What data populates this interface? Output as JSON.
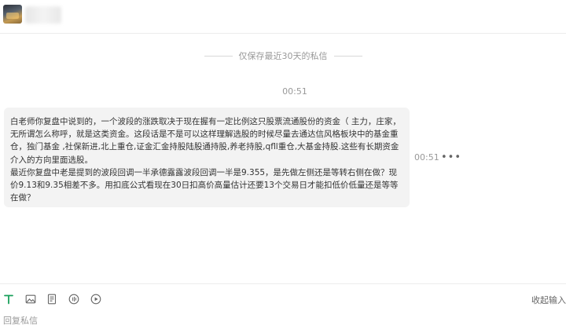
{
  "header": {
    "avatar_icon": "user-avatar-image",
    "name": ""
  },
  "notice": {
    "text": "仅保存最近30天的私信"
  },
  "conversation": {
    "time_divider": "00:51",
    "message": {
      "paragraph1": "白老师你复盘中说到的，一个波段的涨跌取决于现在握有一定比例这只股票流通股份的资金（ 主力，庄家，无所谓怎么称呼，就是这类资金。这段话是不是可以这样理解选股的时候尽量去通达信风格板块中的基金重仓，独门基金 ,社保新进,北上重仓,证金汇金持股陆股通持股,养老持股,qfll重仓,大基金持股.这些有长期资金介入的方向里面选股。",
      "paragraph2": "最近你复盘中老是提到的波段回调一半承德露露波段回调一半是9.355，是先做左侧还是等转右侧在做？现价9.13和9.35相差不多。用扣底公式看现在30日扣高价高量估计还要13个交易日才能扣低价低量还是等等在做？",
      "time": "00:51",
      "more_label": "•••"
    }
  },
  "compose": {
    "tools": [
      {
        "name": "text-format-icon",
        "color": "#19a05b"
      },
      {
        "name": "image-icon"
      },
      {
        "name": "document-icon"
      },
      {
        "name": "audio-icon"
      },
      {
        "name": "video-play-icon"
      }
    ],
    "fold_label": "收起输入",
    "reply_placeholder": "回复私信"
  },
  "colors": {
    "accent_green": "#19a05b",
    "bubble_bg": "#f3f3f3",
    "muted_text": "#999999"
  }
}
